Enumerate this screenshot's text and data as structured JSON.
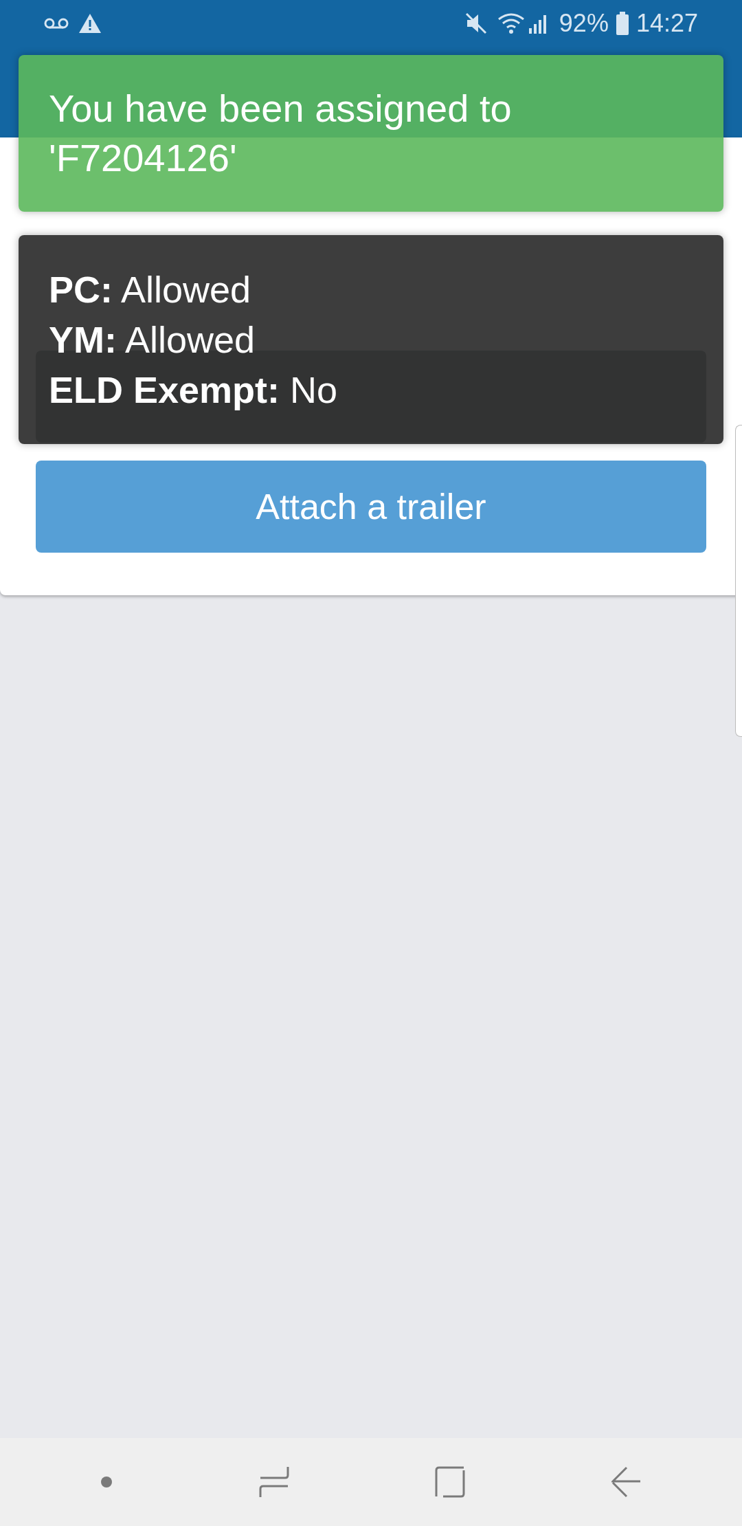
{
  "status_bar": {
    "battery": "92%",
    "time": "14:27"
  },
  "card": {
    "buttons": [
      {
        "label": "Attach a trailer"
      }
    ]
  },
  "toasts": [
    {
      "kind": "success",
      "lines": [
        "You have been assigned to 'F7204126'"
      ]
    },
    {
      "kind": "info",
      "lines": [
        "**PC:** Allowed",
        "**YM:** Allowed",
        "**ELD Exempt:** No"
      ]
    }
  ]
}
